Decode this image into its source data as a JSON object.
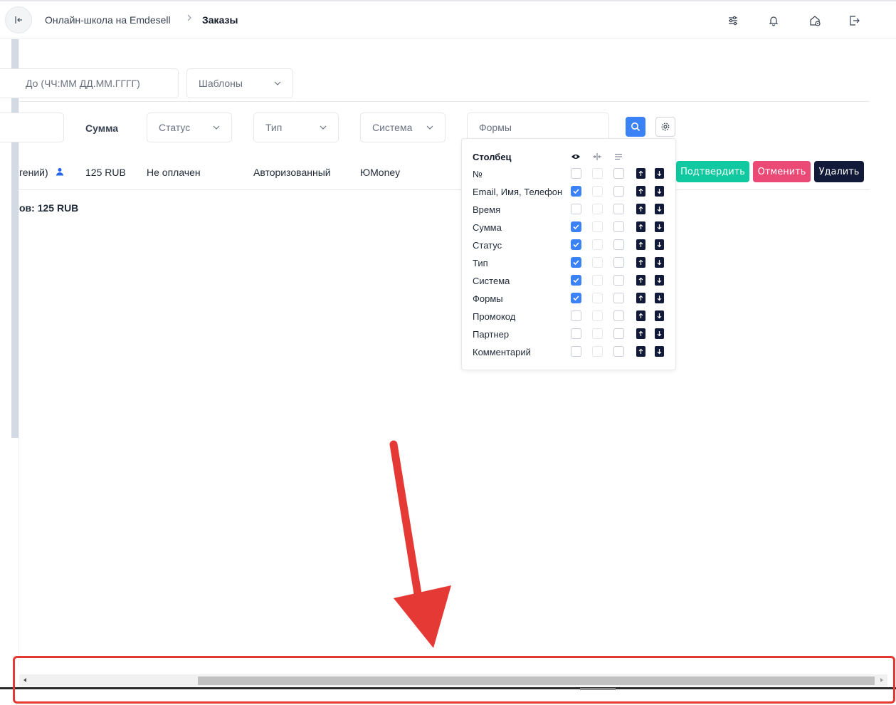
{
  "header": {
    "breadcrumb_root": "Онлайн-школа на Emdesell",
    "breadcrumb_sep": ">",
    "breadcrumb_current": "Заказы"
  },
  "icons": {
    "back": "collapse-left-icon",
    "filters": "sliders-icon",
    "notifications": "bell-icon",
    "home_settings": "home-gear-icon",
    "logout": "logout-icon"
  },
  "filters": {
    "date_to_placeholder": "До (ЧЧ:ММ ДД.ММ.ГГГГ)",
    "templates_label": "Шаблоны",
    "status_label": "Статус",
    "type_label": "Тип",
    "system_label": "Система",
    "forms_label": "Формы"
  },
  "table": {
    "sum_header": "Сумма",
    "row": {
      "client_tail": "гений)",
      "sum": "125 RUB",
      "status": "Не оплачен",
      "type": "Авторизованный",
      "system": "ЮMoney"
    },
    "actions": {
      "confirm": "Подтвердить",
      "cancel": "Отменить",
      "delete": "Удалить"
    },
    "total": "ов: 125 RUB"
  },
  "column_settings": {
    "header_label": "Столбец",
    "columns": [
      {
        "label": "№",
        "visible": false
      },
      {
        "label": "Email, Имя, Телефон",
        "visible": true
      },
      {
        "label": "Время",
        "visible": false
      },
      {
        "label": "Сумма",
        "visible": true
      },
      {
        "label": "Статус",
        "visible": true
      },
      {
        "label": "Тип",
        "visible": true
      },
      {
        "label": "Система",
        "visible": true
      },
      {
        "label": "Формы",
        "visible": true
      },
      {
        "label": "Промокод",
        "visible": false
      },
      {
        "label": "Партнер",
        "visible": false
      },
      {
        "label": "Комментарий",
        "visible": false
      }
    ]
  },
  "colors": {
    "primary": "#3b82f6",
    "confirm": "#10c9a0",
    "cancel": "#ec4a76",
    "delete": "#121a3a",
    "highlight": "#e53935"
  },
  "annotation": {
    "arrow": "red-arrow-annotation",
    "box": "red-highlight-box"
  }
}
